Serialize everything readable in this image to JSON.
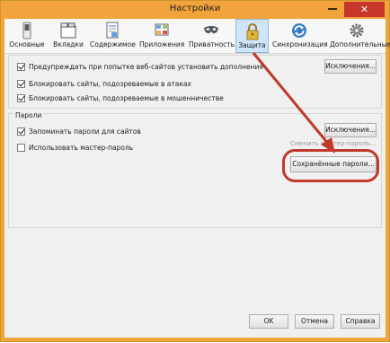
{
  "window": {
    "title": "Настройки",
    "close_glyph": "✕"
  },
  "tabs": [
    {
      "label": "Основные",
      "icon": "switch-icon",
      "active": false
    },
    {
      "label": "Вкладки",
      "icon": "tabs-icon",
      "active": false
    },
    {
      "label": "Содержимое",
      "icon": "page-icon",
      "active": false
    },
    {
      "label": "Приложения",
      "icon": "apps-icon",
      "active": false
    },
    {
      "label": "Приватность",
      "icon": "mask-icon",
      "active": false
    },
    {
      "label": "Защита",
      "icon": "lock-icon",
      "active": true
    },
    {
      "label": "Синхронизация",
      "icon": "sync-icon",
      "active": false
    },
    {
      "label": "Дополнительные",
      "icon": "gear-icon",
      "active": false
    }
  ],
  "security": {
    "warn_addons": {
      "label": "Предупреждать при попытке веб-сайтов установить дополнения",
      "checked": true
    },
    "exceptions_label": "Исключения...",
    "block_attack": {
      "label": "Блокировать сайты, подозреваемые в атаках",
      "checked": true
    },
    "block_fraud": {
      "label": "Блокировать сайты, подозреваемые в мошенничестве",
      "checked": true
    }
  },
  "passwords": {
    "title": "Пароли",
    "remember": {
      "label": "Запоминать пароли для сайтов",
      "checked": true
    },
    "exceptions_label": "Исключения...",
    "master": {
      "label": "Использовать мастер-пароль",
      "checked": false
    },
    "change_master_label": "Сменить мастер-пароль...",
    "saved_label": "Сохранённые пароли..."
  },
  "footer": {
    "ok": "OK",
    "cancel": "Отмена",
    "help": "Справка"
  },
  "colors": {
    "accent": "#f3a33b",
    "highlight": "#c0392b"
  }
}
